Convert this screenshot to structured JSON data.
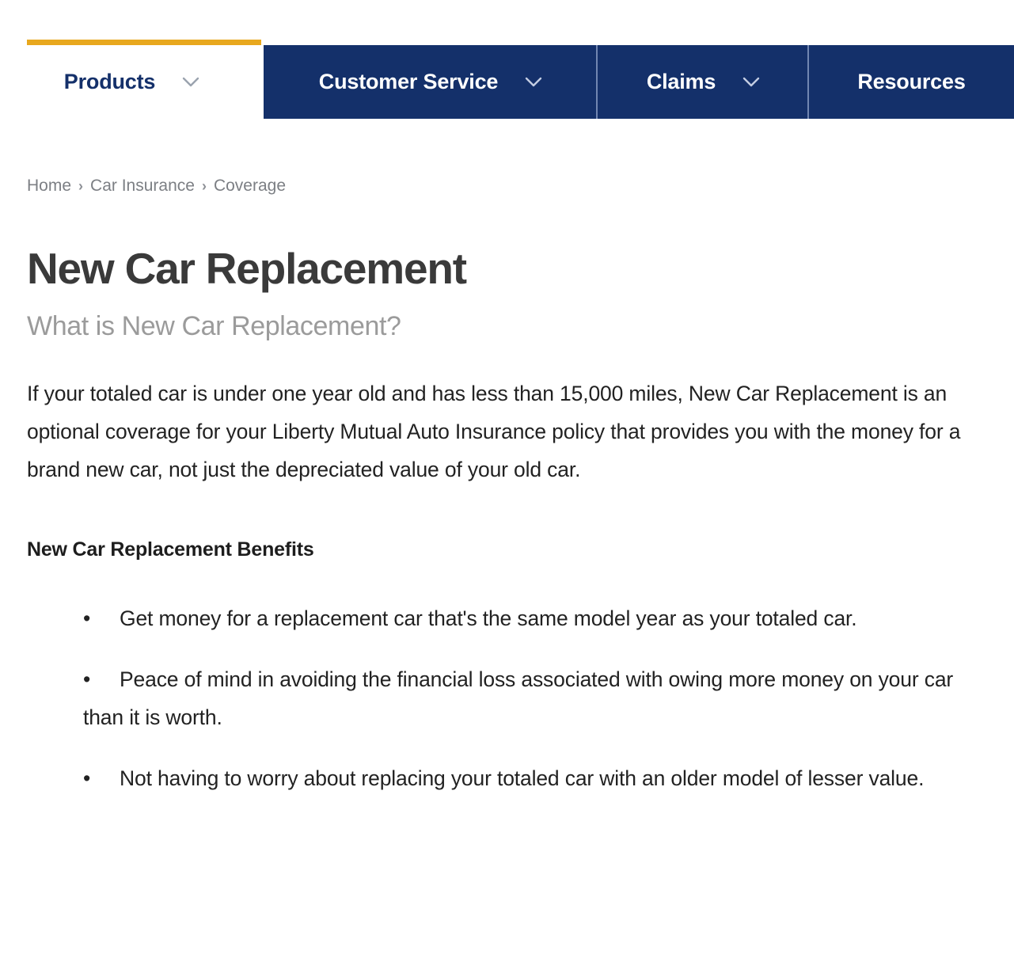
{
  "nav": {
    "items": [
      {
        "label": "Products",
        "has_chevron": true,
        "active": true,
        "icon": "chevron-down-icon"
      },
      {
        "label": "Customer Service",
        "has_chevron": true,
        "active": false,
        "icon": "chevron-down-icon"
      },
      {
        "label": "Claims",
        "has_chevron": true,
        "active": false,
        "icon": "chevron-down-icon"
      },
      {
        "label": "Resources",
        "has_chevron": false,
        "active": false,
        "icon": ""
      }
    ],
    "accent_color": "#e8a81e",
    "bar_color": "#14306a",
    "active_text_color": "#14306a"
  },
  "breadcrumb": {
    "separator": "›",
    "items": [
      {
        "label": "Home"
      },
      {
        "label": "Car Insurance"
      },
      {
        "label": "Coverage"
      }
    ]
  },
  "page": {
    "title": "New Car Replacement",
    "subtitle": "What is New Car Replacement?",
    "intro": "If your totaled car is under one year old and has less than 15,000 miles, New Car Replacement is an optional coverage for your Liberty Mutual Auto Insurance policy that provides you with the money for a brand new car, not just the depreciated value of your old car.",
    "benefits_heading": "New Car Replacement Benefits",
    "bullet_glyph": "•",
    "benefits": [
      "Get money for a replacement car that's the same model year as your totaled car.",
      "Peace of mind in avoiding the financial loss associated with owing more money on your car than it is worth.",
      "Not having to worry about replacing your totaled car with an older model of lesser value."
    ]
  }
}
